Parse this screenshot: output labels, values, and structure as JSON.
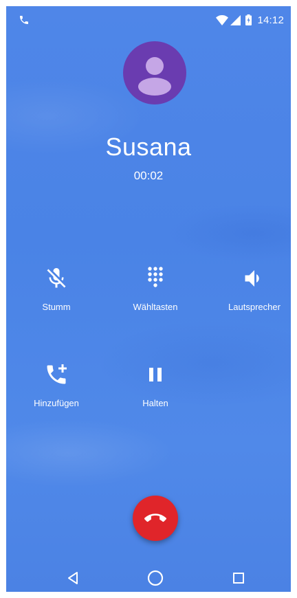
{
  "status_bar": {
    "time": "14:12",
    "icons": [
      "ongoing-call-icon",
      "wifi-icon",
      "cell-signal-icon",
      "battery-icon"
    ]
  },
  "call": {
    "caller_name": "Susana",
    "duration": "00:02",
    "avatar_icon": "person-icon"
  },
  "controls": [
    {
      "icon": "mute-mic-icon",
      "label": "Stumm"
    },
    {
      "icon": "dialpad-icon",
      "label": "Wähltasten"
    },
    {
      "icon": "speaker-icon",
      "label": "Lautsprecher"
    },
    {
      "icon": "add-call-icon",
      "label": "Hinzufügen"
    },
    {
      "icon": "pause-icon",
      "label": "Halten"
    }
  ],
  "end_call": {
    "icon": "end-call-icon",
    "color": "#e0252a"
  },
  "nav_bar": {
    "icons": [
      "back-icon",
      "home-icon",
      "recents-icon"
    ]
  },
  "colors": {
    "background": "#4f86e8",
    "avatar": "#6a3cb0",
    "avatar_figure": "#c5a6e6"
  }
}
